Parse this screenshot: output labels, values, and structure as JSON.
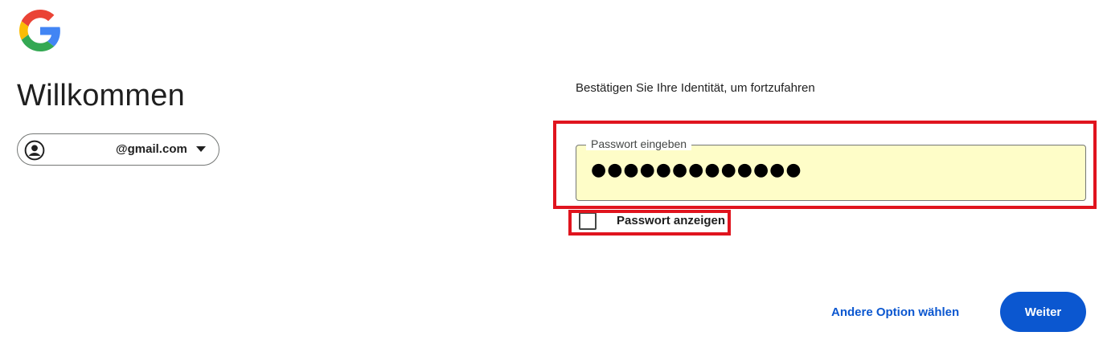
{
  "logo": {
    "icon": "google-g-logo-icon"
  },
  "heading": {
    "title": "Willkommen"
  },
  "account": {
    "email": "@gmail.com",
    "avatar_icon": "account-circle-icon",
    "dropdown_icon": "caret-down-icon"
  },
  "form": {
    "subtitle": "Bestätigen Sie Ihre Identität, um fortzufahren",
    "password_label": "Passwort eingeben",
    "password_value": "●●●●●●●●●●●●●",
    "show_password_label": "Passwort anzeigen",
    "show_password_checked": false
  },
  "actions": {
    "other_option": "Andere Option wählen",
    "next": "Weiter"
  },
  "colors": {
    "primary": "#0b57d0",
    "highlight": "#e0141e",
    "autofill": "#fefdc8"
  }
}
